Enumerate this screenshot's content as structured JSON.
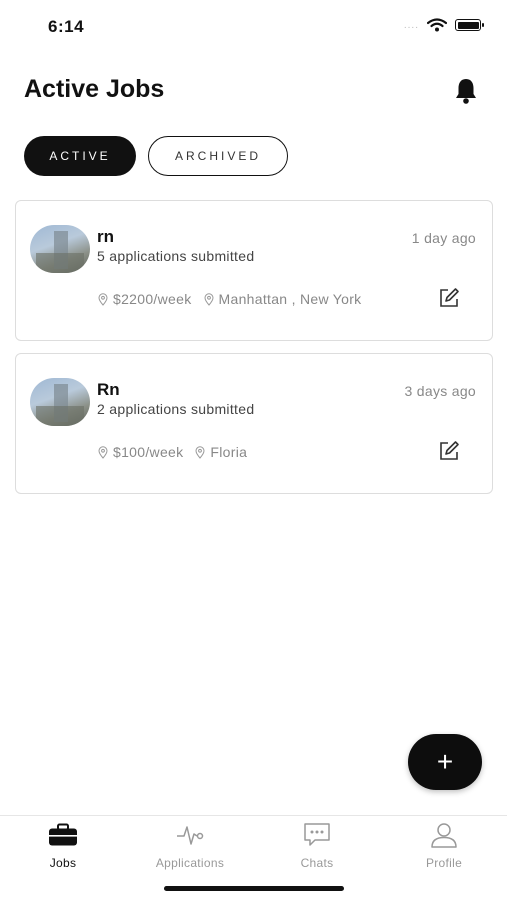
{
  "status_bar": {
    "time": "6:14",
    "signal": "....",
    "icons": [
      "wifi-icon",
      "battery-icon"
    ]
  },
  "header": {
    "title": "Active Jobs",
    "notification_icon": "bell-icon"
  },
  "tabs": [
    {
      "label": "ACTIVE",
      "selected": true
    },
    {
      "label": "ARCHIVED",
      "selected": false
    }
  ],
  "jobs": [
    {
      "title": "rn",
      "applications": "5 applications submitted",
      "posted": "1 day ago",
      "salary": "$2200/week",
      "location": "Manhattan , New York"
    },
    {
      "title": "Rn",
      "applications": "2 applications submitted",
      "posted": "3 days ago",
      "salary": "$100/week",
      "location": "Floria"
    }
  ],
  "fab": {
    "label": "+"
  },
  "bottom_nav": [
    {
      "label": "Jobs",
      "icon": "briefcase-icon",
      "active": true
    },
    {
      "label": "Applications",
      "icon": "activity-icon",
      "active": false
    },
    {
      "label": "Chats",
      "icon": "chat-icon",
      "active": false
    },
    {
      "label": "Profile",
      "icon": "user-icon",
      "active": false
    }
  ],
  "colors": {
    "primary": "#111111",
    "muted_text": "#888888",
    "card_border": "#dddddd"
  }
}
